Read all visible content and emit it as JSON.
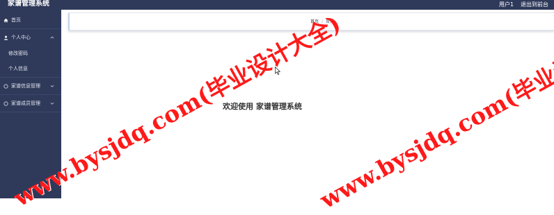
{
  "topbar": {
    "title": "家谱管理系统",
    "user": "用户1",
    "exit": "退出到前台",
    "background_color": "#2f3a5a"
  },
  "sidebar": {
    "background_color": "#2f3a5a",
    "items": [
      {
        "label": "首页",
        "icon": "home-icon"
      },
      {
        "label": "个人中心",
        "icon": "user-icon",
        "expanded": true,
        "children": [
          {
            "label": "修改密码"
          },
          {
            "label": "个人信息"
          }
        ]
      },
      {
        "label": "家谱信息管理",
        "icon": "circle-icon",
        "expanded": false
      },
      {
        "label": "家谱成员管理",
        "icon": "circle-icon",
        "expanded": false
      }
    ]
  },
  "breadcrumb": {
    "items": [
      "首页",
      "首页"
    ],
    "separator": "/"
  },
  "main": {
    "welcome_text": "欢迎使用 家谱管理系统"
  },
  "watermark": {
    "line_1": "www.bysjdq.com(毕业设计大全)",
    "line_2": "www.bysjdq.com(毕业设计大全)",
    "color": "#ff1a1a"
  }
}
